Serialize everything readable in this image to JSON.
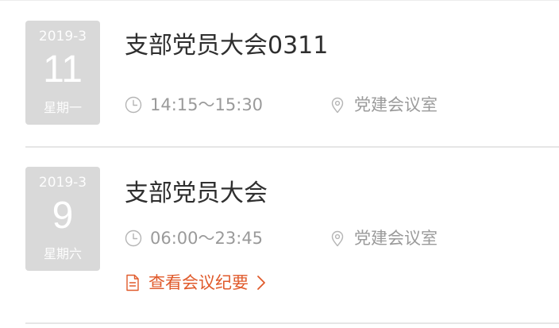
{
  "meetings": [
    {
      "date": {
        "month": "2019-3",
        "day": "11",
        "weekday": "星期一"
      },
      "title": "支部党员大会0311",
      "time": "14:15～15:30",
      "location": "党建会议室",
      "icons": {
        "time": "clock-icon",
        "location": "location-pin-icon"
      }
    },
    {
      "date": {
        "month": "2019-3",
        "day": "9",
        "weekday": "星期六"
      },
      "title": "支部党员大会",
      "time": "06:00～23:45",
      "location": "党建会议室",
      "minutes_link": "查看会议纪要",
      "icons": {
        "time": "clock-icon",
        "location": "location-pin-icon",
        "minutes": "document-icon",
        "chevron": "chevron-right-icon"
      }
    }
  ],
  "colors": {
    "tile_bg": "#d9d9d9",
    "title": "#2f2f2f",
    "meta": "#9a9a9a",
    "link_accent": "#e05a2b",
    "divider": "#e6e6e6"
  }
}
